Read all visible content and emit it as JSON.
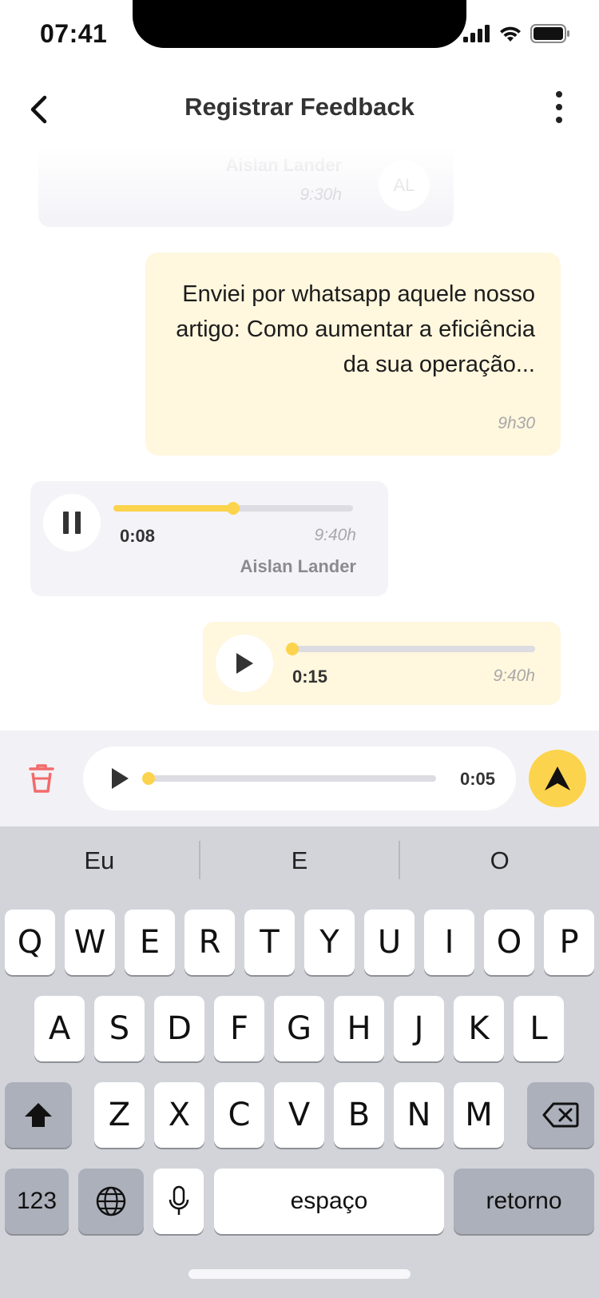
{
  "status_bar": {
    "time": "07:41"
  },
  "header": {
    "title": "Registrar Feedback"
  },
  "chat": {
    "faded_message": {
      "sender": "Aislan Lander",
      "time": "9:30h",
      "avatar_initials": "AL"
    },
    "text_message": {
      "text": "Enviei por whatsapp aquele nosso artigo: Como aumentar a eficiência da sua operação...",
      "time": "9h30"
    },
    "audio_incoming": {
      "duration": "0:08",
      "time": "9:40h",
      "sender": "Aislan Lander",
      "progress": 0.5,
      "state": "pause-icon"
    },
    "audio_outgoing": {
      "duration": "0:15",
      "time": "9:40h",
      "progress": 0.0,
      "state": "play-icon"
    }
  },
  "record_bar": {
    "duration": "0:05",
    "progress": 0.0
  },
  "keyboard": {
    "suggestions": [
      "Eu",
      "E",
      "O"
    ],
    "row1": [
      "Q",
      "W",
      "E",
      "R",
      "T",
      "Y",
      "U",
      "I",
      "O",
      "P"
    ],
    "row2": [
      "A",
      "S",
      "D",
      "F",
      "G",
      "H",
      "J",
      "K",
      "L"
    ],
    "row3": [
      "Z",
      "X",
      "C",
      "V",
      "B",
      "N",
      "M"
    ],
    "numbers_label": "123",
    "space_label": "espaço",
    "return_label": "retorno"
  },
  "colors": {
    "accent": "#fcd34d",
    "outgoing_bubble": "#fff7de",
    "incoming_bubble": "#f4f4f8",
    "delete": "#f26b6b"
  }
}
